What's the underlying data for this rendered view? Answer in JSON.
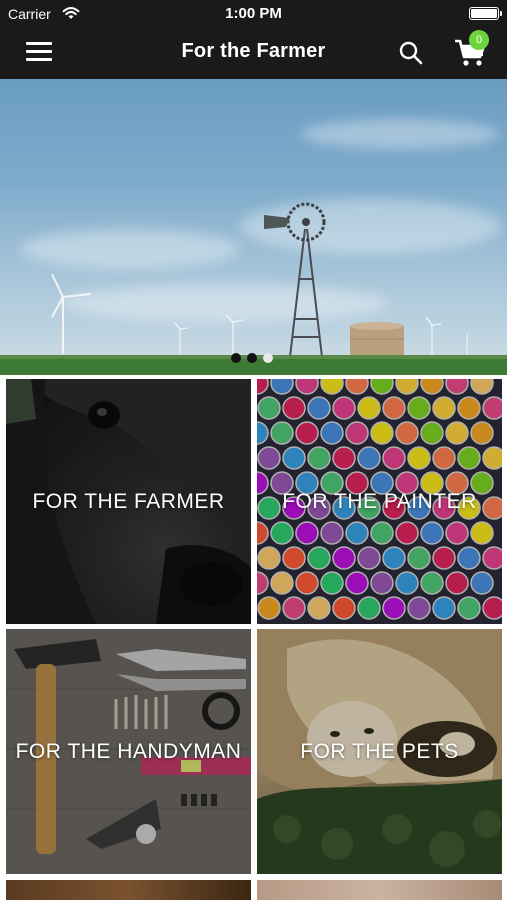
{
  "status_bar": {
    "carrier": "Carrier",
    "time": "1:00 PM"
  },
  "navbar": {
    "title": "For the Farmer",
    "cart_count": "0"
  },
  "icons": {
    "menu": "hamburger-menu-icon",
    "search": "search-icon",
    "cart": "shopping-cart-icon"
  },
  "hero": {
    "slide_count": 3,
    "active_slide": 3
  },
  "categories": [
    {
      "label": "FOR THE FARMER"
    },
    {
      "label": "FOR THE PAINTER"
    },
    {
      "label": "FOR THE HANDYMAN"
    },
    {
      "label": "FOR THE PETS"
    }
  ],
  "colors": {
    "navbar_bg": "#1a1a1a",
    "badge": "#6dd33a",
    "text": "#ffffff"
  }
}
